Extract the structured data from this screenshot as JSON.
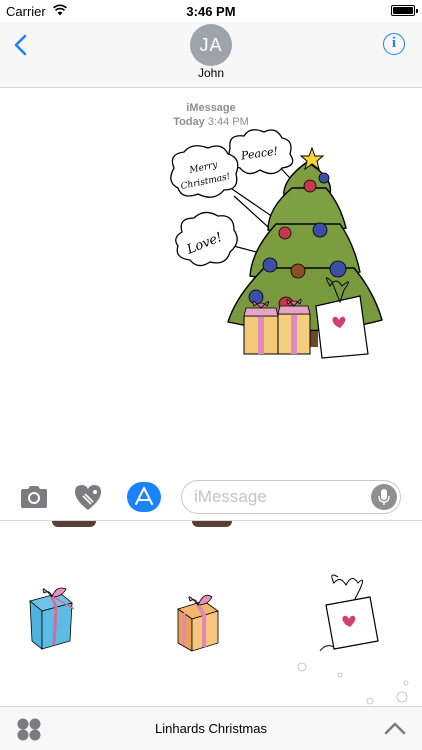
{
  "status_bar": {
    "carrier": "Carrier",
    "time": "3:46 PM"
  },
  "header": {
    "contact_initials": "JA",
    "contact_name": "John",
    "info_label": "i"
  },
  "conversation": {
    "service": "iMessage",
    "day": "Today",
    "time": "3:44 PM",
    "sticker": {
      "speech_bubbles": [
        "Peace!",
        "Merry",
        "Christmas!",
        "Love!"
      ]
    }
  },
  "input_bar": {
    "placeholder": "iMessage",
    "value": ""
  },
  "drawer": {
    "stickers": [
      "blue-gift-box-sticker",
      "gold-gift-box-sticker",
      "gift-tag-heart-sticker"
    ]
  },
  "bottom_bar": {
    "pack_name": "Linhards Christmas"
  },
  "colors": {
    "accent": "#1a82fb",
    "avatar_bg": "#9fa3ab",
    "muted_text": "#8e8e93"
  },
  "icons": [
    "wifi-icon",
    "battery-icon",
    "back-chevron-icon",
    "info-icon",
    "camera-icon",
    "digital-touch-heart-icon",
    "app-store-icon",
    "microphone-icon",
    "app-drawer-icon",
    "expand-chevron-icon"
  ]
}
